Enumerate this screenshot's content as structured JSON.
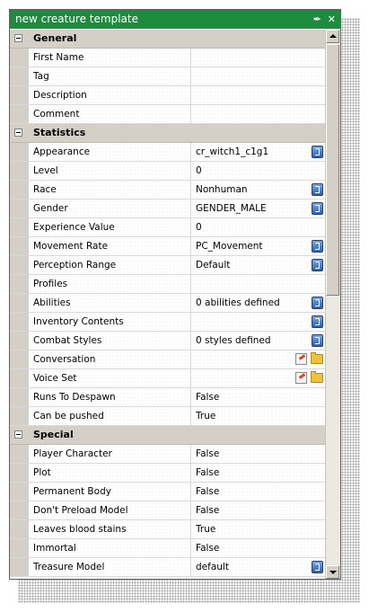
{
  "window": {
    "title": "new creature template",
    "pin_icon": "pin-icon",
    "close_icon": "close-icon"
  },
  "categories": [
    {
      "label": "General",
      "rows": [
        {
          "name": "First Name",
          "value": "",
          "buttons": []
        },
        {
          "name": "Tag",
          "value": "",
          "buttons": []
        },
        {
          "name": "Description",
          "value": "",
          "buttons": []
        },
        {
          "name": "Comment",
          "value": "",
          "buttons": []
        }
      ]
    },
    {
      "label": "Statistics",
      "rows": [
        {
          "name": "Appearance",
          "value": "cr_witch1_c1g1",
          "buttons": [
            "book"
          ]
        },
        {
          "name": "Level",
          "value": "0",
          "buttons": []
        },
        {
          "name": "Race",
          "value": "Nonhuman",
          "buttons": [
            "book"
          ]
        },
        {
          "name": "Gender",
          "value": "GENDER_MALE",
          "buttons": [
            "book"
          ]
        },
        {
          "name": "Experience Value",
          "value": "0",
          "buttons": []
        },
        {
          "name": "Movement Rate",
          "value": "PC_Movement",
          "buttons": [
            "book"
          ]
        },
        {
          "name": "Perception Range",
          "value": "Default",
          "buttons": [
            "book"
          ]
        },
        {
          "name": "Profiles",
          "value": "",
          "buttons": []
        },
        {
          "name": "Abilities",
          "value": "0 abilities defined",
          "buttons": [
            "book"
          ]
        },
        {
          "name": "Inventory Contents",
          "value": "",
          "buttons": [
            "book"
          ]
        },
        {
          "name": "Combat Styles",
          "value": "0 styles defined",
          "buttons": [
            "book"
          ]
        },
        {
          "name": "Conversation",
          "value": "",
          "buttons": [
            "edit",
            "folder"
          ]
        },
        {
          "name": "Voice Set",
          "value": "",
          "buttons": [
            "edit",
            "folder"
          ]
        },
        {
          "name": "Runs To Despawn",
          "value": "False",
          "buttons": []
        },
        {
          "name": "Can be pushed",
          "value": "True",
          "buttons": []
        }
      ]
    },
    {
      "label": "Special",
      "rows": [
        {
          "name": "Player Character",
          "value": "False",
          "buttons": []
        },
        {
          "name": "Plot",
          "value": "False",
          "buttons": []
        },
        {
          "name": "Permanent Body",
          "value": "False",
          "buttons": []
        },
        {
          "name": "Don't Preload Model",
          "value": "False",
          "buttons": []
        },
        {
          "name": "Leaves blood stains",
          "value": "True",
          "buttons": []
        },
        {
          "name": "Immortal",
          "value": "False",
          "buttons": []
        },
        {
          "name": "Treasure Model",
          "value": "default",
          "buttons": [
            "book"
          ]
        }
      ]
    }
  ],
  "colors": {
    "titlebar": "#1d8d3d",
    "category_bg": "#d4d0c8",
    "grid_line": "#d8d8d8"
  }
}
